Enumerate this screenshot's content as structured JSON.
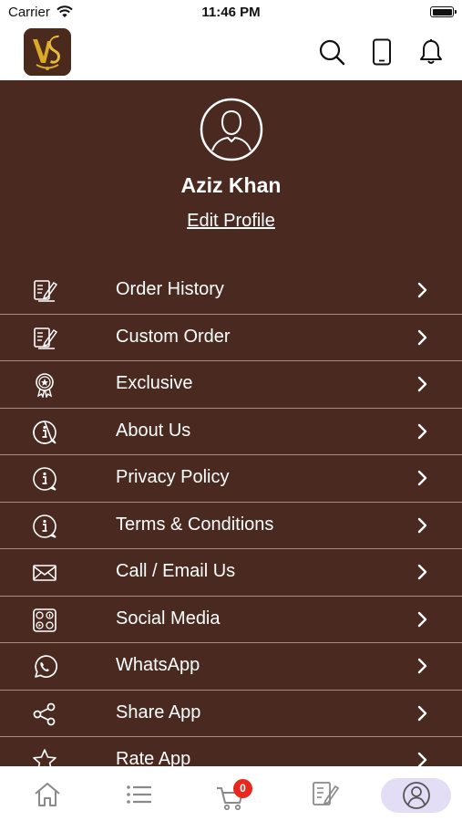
{
  "status_bar": {
    "carrier": "Carrier",
    "time": "11:46 PM"
  },
  "header": {
    "logo_icon": "vs-brand-logo",
    "icons": [
      "search-icon",
      "phone-icon",
      "bell-icon"
    ]
  },
  "profile": {
    "name": "Aziz Khan",
    "edit_label": "Edit Profile",
    "avatar_icon": "user-avatar-icon"
  },
  "menu": [
    {
      "label": "Order History",
      "icon": "order-list-icon"
    },
    {
      "label": "Custom Order",
      "icon": "custom-order-icon"
    },
    {
      "label": "Exclusive",
      "icon": "badge-star-icon"
    },
    {
      "label": "About Us",
      "icon": "info-icon"
    },
    {
      "label": "Privacy Policy",
      "icon": "info-icon"
    },
    {
      "label": "Terms & Conditions",
      "icon": "info-icon"
    },
    {
      "label": "Call / Email Us",
      "icon": "mail-icon"
    },
    {
      "label": "Social Media",
      "icon": "social-media-icon"
    },
    {
      "label": "WhatsApp",
      "icon": "whatsapp-icon"
    },
    {
      "label": "Share App",
      "icon": "share-icon"
    },
    {
      "label": "Rate App",
      "icon": "star-icon"
    }
  ],
  "bottom_nav": {
    "items": [
      "home-icon",
      "list-icon",
      "cart-icon",
      "order-icon",
      "profile-icon"
    ],
    "cart_count": "0",
    "active": "profile"
  },
  "colors": {
    "brown": "#4a2a20",
    "divider": "#a58c84",
    "gold": "#d9a928",
    "active_pill": "#e3ddf5",
    "badge_red": "#e8281d"
  }
}
